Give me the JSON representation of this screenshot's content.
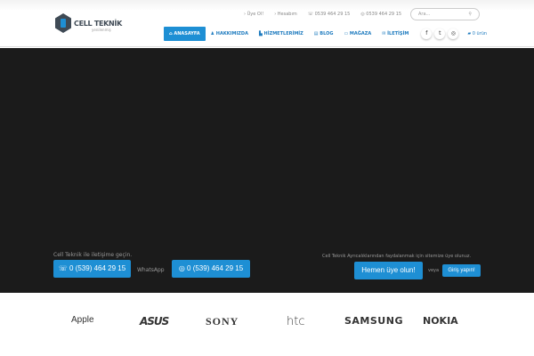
{
  "header": {
    "logo": "CELL TEKNİK",
    "logo_sub": "yenilenmiş",
    "top_links": [
      "› Üye Ol!",
      "› Hesabım",
      "☏ 0539 464 29 15",
      "◎ 0539 464 29 15"
    ],
    "search_placeholder": "Ara..."
  },
  "nav": {
    "items": [
      "⌂ ANASAYFA",
      "♟ HAKKIMIZDA",
      "▙ HİZMETLERİMİZ",
      "▤ BLOG",
      "▭ MAĞAZA",
      "✉ İLETİŞİM"
    ],
    "social": [
      "f",
      "t",
      "◎"
    ],
    "cart": "0 ürün"
  },
  "contact": {
    "label": "Cell Teknik ile iletişime geçin.",
    "phone": "☏  0 (539) 464 29 15",
    "whatsapp_label": "WhatsApp",
    "whatsapp": "◎  0 (539) 464 29 15"
  },
  "member": {
    "label": "Cell Teknik Ayrıcalıklarından faydalanmak için sitemize üye olunuz.",
    "signup": "Hemen üye olun!",
    "or": "veya",
    "login": "Giriş yapın!"
  },
  "brands": [
    "Apple",
    "ASUS",
    "SONY",
    "htc",
    "SAMSUNG",
    "NOKIA"
  ],
  "colors": {
    "accent": "#1e8fd4",
    "hero": "#1b1b1b"
  }
}
